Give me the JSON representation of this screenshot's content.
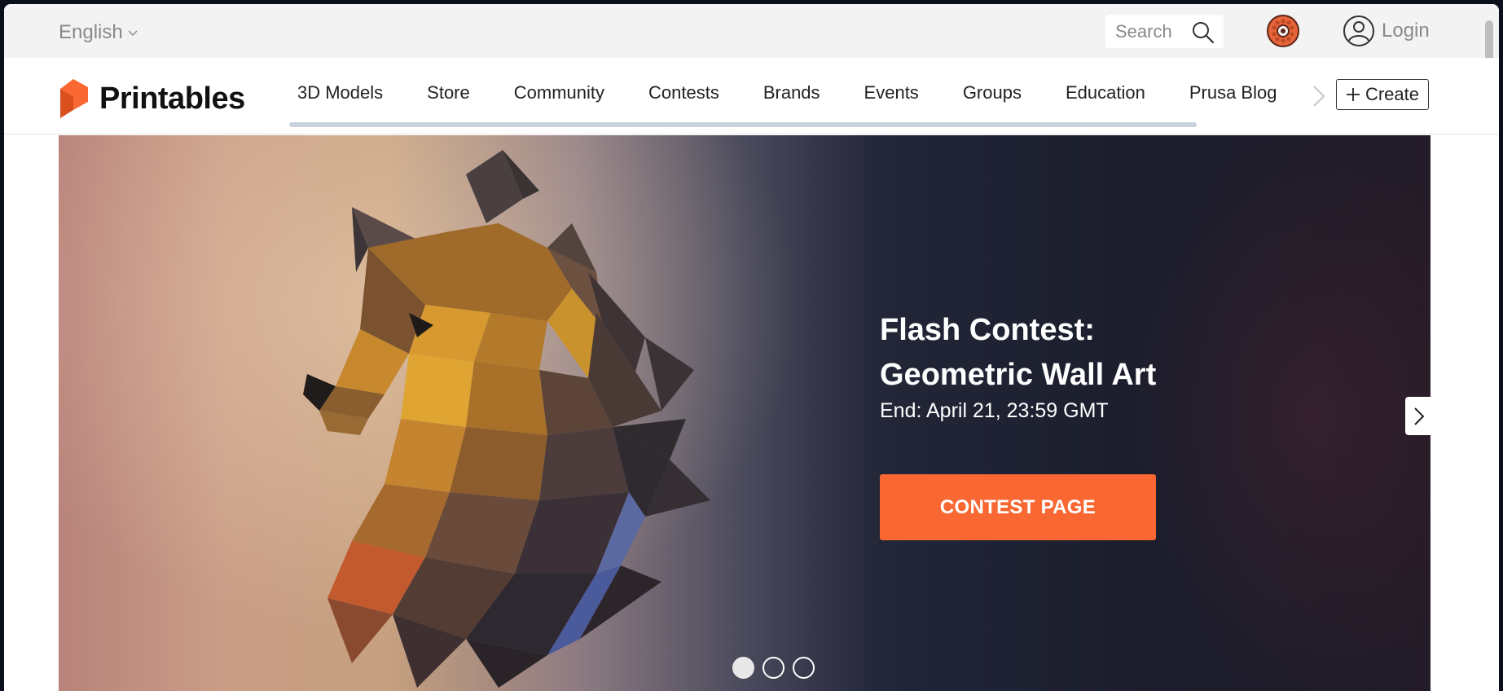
{
  "topbar": {
    "language": "English",
    "search_placeholder": "Search",
    "login_label": "Login"
  },
  "brand": {
    "name": "Printables",
    "accent": "#f96832"
  },
  "nav": {
    "items": [
      "3D Models",
      "Store",
      "Community",
      "Contests",
      "Brands",
      "Events",
      "Groups",
      "Education",
      "Prusa Blog"
    ],
    "create_label": "Create"
  },
  "hero": {
    "title_line1": "Flash Contest:",
    "title_line2": "Geometric Wall Art",
    "end_text": "End: April 21, 23:59 GMT",
    "button_label": "CONTEST PAGE",
    "slides_total": 3,
    "active_slide": 1
  },
  "icons": [
    "chevron-down-icon",
    "search-icon",
    "filament-spool-icon",
    "user-circle-icon",
    "chevron-right-icon",
    "plus-icon"
  ]
}
